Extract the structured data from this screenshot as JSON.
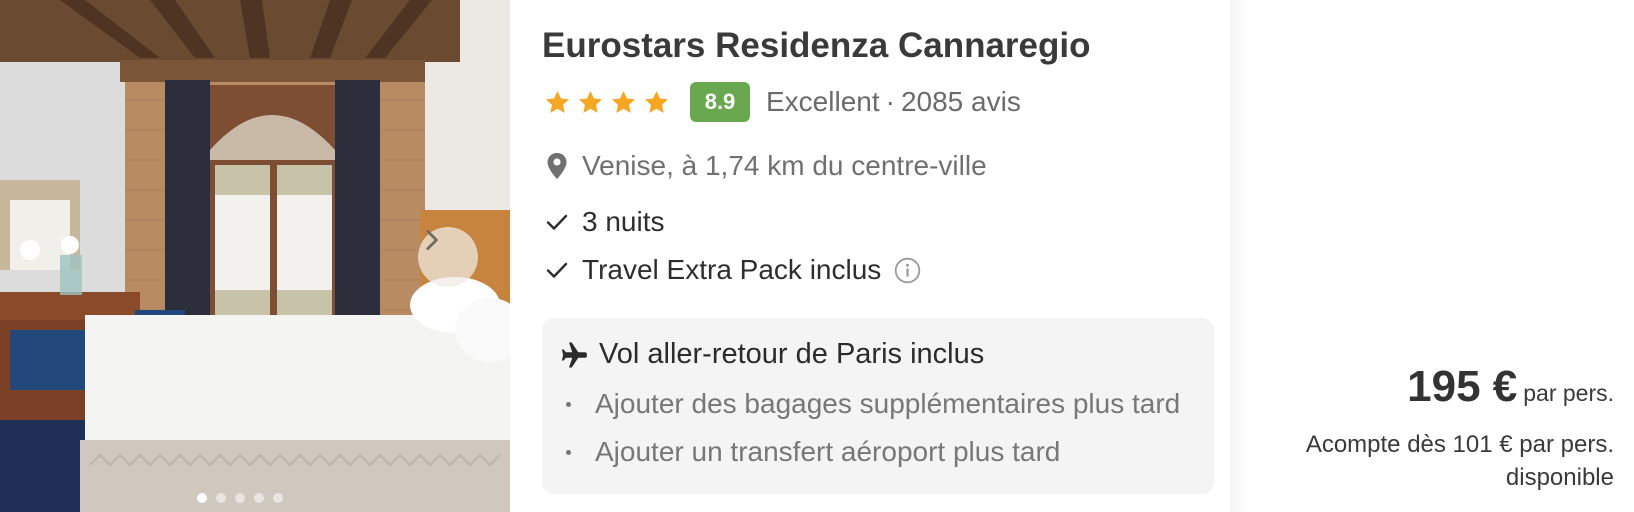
{
  "hotel": {
    "name": "Eurostars Residenza Cannaregio",
    "stars": 4,
    "score": "8.9",
    "rating_label": "Excellent",
    "separator": "·",
    "reviews": "2085 avis",
    "location": "Venise, à 1,74 km du centre-ville",
    "features": [
      "3 nuits",
      "Travel Extra Pack inclus"
    ]
  },
  "flight": {
    "title": "Vol aller-retour de Paris inclus",
    "options": [
      "Ajouter des bagages supplémentaires plus tard",
      "Ajouter un transfert aéroport plus tard"
    ]
  },
  "price": {
    "amount": "195 €",
    "unit": "par pers.",
    "deposit": "Acompte dès 101 € par pers. disponible"
  },
  "gallery": {
    "image_count": 5,
    "current_index": 1
  },
  "colors": {
    "star": "#f5a623",
    "score_badge": "#6aa84f",
    "flight_box": "#f4f4f4"
  },
  "icons": {
    "location": "map-pin-icon",
    "feature": "check-icon",
    "info": "info-icon",
    "flight": "plane-icon",
    "next": "chevron-right-icon"
  }
}
